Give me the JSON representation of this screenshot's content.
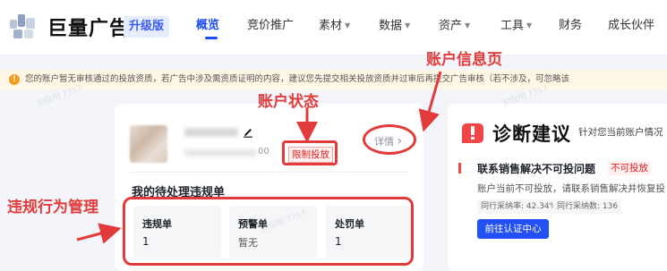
{
  "topbar": {
    "brand": "巨量广告",
    "edition": "升级版",
    "nav": [
      {
        "label": "概览",
        "active": true,
        "caret": false
      },
      {
        "label": "竞价推广",
        "active": false,
        "caret": false
      },
      {
        "label": "素材",
        "active": false,
        "caret": true
      },
      {
        "label": "数据",
        "active": false,
        "caret": true
      },
      {
        "label": "资产",
        "active": false,
        "caret": true
      },
      {
        "label": "工具",
        "active": false,
        "caret": true
      },
      {
        "label": "财务",
        "active": false,
        "caret": false
      },
      {
        "label": "成长伙伴",
        "active": false,
        "caret": false
      }
    ],
    "caret_glyph": "▼"
  },
  "banner": {
    "icon": "!",
    "text": "您的账户暂无审核通过的投放资质，若广告中涉及需资质证明的内容，建议您先提交相关投放资质并过审后再提交广告审核（若不涉及，可忽略该"
  },
  "account": {
    "id_suffix": "00",
    "status": "限制投放",
    "detail": "详情",
    "detail_chevron": "›"
  },
  "violations": {
    "title": "我的待处理违规单",
    "items": [
      {
        "label": "违规单",
        "value": "1"
      },
      {
        "label": "预警单",
        "value": "暂无"
      },
      {
        "label": "处罚单",
        "value": "1"
      }
    ]
  },
  "diagnosis": {
    "title": "诊断建议",
    "subtitle": "针对您当前账户情况",
    "issue_title": "联系销售解决不可投问题",
    "issue_tag": "不可投放",
    "issue_desc": "账户当前不可投放，请联系销售解决并恢复投",
    "metrics": [
      "同行采纳率: 42.34%",
      "同行采纳数: 136"
    ],
    "cta": "前往认证中心"
  },
  "annotations": {
    "account_info": "账户信息页",
    "account_status": "账户状态",
    "violation_mgmt": "违规行为管理"
  },
  "watermark": "刘仪明 7757",
  "colors": {
    "accent": "#1c4cf5",
    "danger": "#e02020",
    "annotation": "#e23b3b",
    "warning": "#fa9c1b"
  }
}
